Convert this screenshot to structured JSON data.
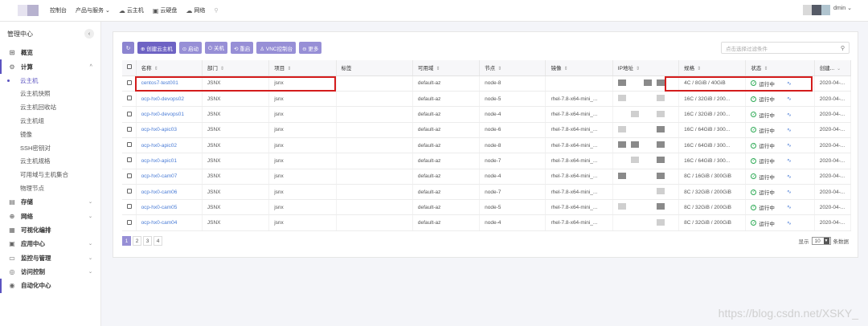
{
  "topbar": {
    "nav": [
      {
        "icon": "",
        "label": "控制台"
      },
      {
        "icon": "",
        "label": "产品与服务 ⌄"
      },
      {
        "icon": "☁",
        "label": "云主机"
      },
      {
        "icon": "▣",
        "label": "云硬盘"
      },
      {
        "icon": "☁",
        "label": "网络"
      }
    ],
    "user": "dmin ⌄"
  },
  "sidebar": {
    "title": "管理中心",
    "items": [
      {
        "icon": "⊞",
        "label": "概览"
      },
      {
        "icon": "⚙",
        "label": "计算",
        "chevron": "^"
      },
      {
        "icon": "▤",
        "label": "存储",
        "chevron": "⌄"
      },
      {
        "icon": "⊕",
        "label": "网络",
        "chevron": "⌄"
      },
      {
        "icon": "▦",
        "label": "可视化编排"
      },
      {
        "icon": "▣",
        "label": "应用中心",
        "chevron": "⌄"
      },
      {
        "icon": "▭",
        "label": "监控与管理",
        "chevron": "⌄"
      },
      {
        "icon": "◎",
        "label": "访问控制",
        "chevron": "⌄"
      },
      {
        "icon": "◉",
        "label": "自动化中心"
      }
    ],
    "compute_subitems": [
      "云主机",
      "云主机快照",
      "云主机回收站",
      "云主机组",
      "镜像",
      "SSH密钥对",
      "云主机规格",
      "可用域与主机集合",
      "物理节点"
    ]
  },
  "toolbar": {
    "refresh": "↻",
    "create": "⊕ 创建云主机",
    "start": "⊙ 启动",
    "stop": "⏻ 关机",
    "restart": "⟲ 重启",
    "vnc": "♙ VNC控制台",
    "more": "⊖ 更多"
  },
  "search": {
    "placeholder": "点击选择过滤条件",
    "icon": "search-icon"
  },
  "table": {
    "headers": [
      "名称",
      "部门",
      "项目",
      "标签",
      "可用域",
      "节点",
      "镜像",
      "IP地址",
      "规格",
      "状态",
      "创建..."
    ],
    "rows": [
      {
        "name": "centos7-test001",
        "dept": "JSNX",
        "project": "jsnx",
        "tag": "",
        "az": "default-az",
        "node": "node-8",
        "image": "",
        "spec": "4C / 8GiB / 40GiB",
        "status": "运行中",
        "created": "2020-04-..."
      },
      {
        "name": "ocp-hx0-devops02",
        "dept": "JSNX",
        "project": "jsnx",
        "tag": "",
        "az": "default-az",
        "node": "node-5",
        "image": "rhel-7.8-x64-mini_...",
        "spec": "16C / 32GiB / 200...",
        "status": "运行中",
        "created": "2020-04-..."
      },
      {
        "name": "ocp-hx0-devops01",
        "dept": "JSNX",
        "project": "jsnx",
        "tag": "",
        "az": "default-az",
        "node": "node-4",
        "image": "rhel-7.8-x64-mini_...",
        "spec": "16C / 32GiB / 200...",
        "status": "运行中",
        "created": "2020-04-..."
      },
      {
        "name": "ocp-hx0-apic03",
        "dept": "JSNX",
        "project": "jsnx",
        "tag": "",
        "az": "default-az",
        "node": "node-6",
        "image": "rhel-7.8-x64-mini_...",
        "spec": "16C / 64GiB / 300...",
        "status": "运行中",
        "created": "2020-04-..."
      },
      {
        "name": "ocp-hx0-apic02",
        "dept": "JSNX",
        "project": "jsnx",
        "tag": "",
        "az": "default-az",
        "node": "node-8",
        "image": "rhel-7.8-x64-mini_...",
        "spec": "16C / 64GiB / 300...",
        "status": "运行中",
        "created": "2020-04-..."
      },
      {
        "name": "ocp-hx0-apic01",
        "dept": "JSNX",
        "project": "jsnx",
        "tag": "",
        "az": "default-az",
        "node": "node-7",
        "image": "rhel-7.8-x64-mini_...",
        "spec": "16C / 64GiB / 300...",
        "status": "运行中",
        "created": "2020-04-..."
      },
      {
        "name": "ocp-hx0-cam07",
        "dept": "JSNX",
        "project": "jsnx",
        "tag": "",
        "az": "default-az",
        "node": "node-4",
        "image": "rhel-7.8-x64-mini_...",
        "spec": "8C / 16GiB / 300GiB",
        "status": "运行中",
        "created": "2020-04-..."
      },
      {
        "name": "ocp-hx0-cam06",
        "dept": "JSNX",
        "project": "jsnx",
        "tag": "",
        "az": "default-az",
        "node": "node-7",
        "image": "rhel-7.8-x64-mini_...",
        "spec": "8C / 32GiB / 200GiB",
        "status": "运行中",
        "created": "2020-04-..."
      },
      {
        "name": "ocp-hx0-cam05",
        "dept": "JSNX",
        "project": "jsnx",
        "tag": "",
        "az": "default-az",
        "node": "node-5",
        "image": "rhel-7.8-x64-mini_...",
        "spec": "8C / 32GiB / 200GiB",
        "status": "运行中",
        "created": "2020-04-..."
      },
      {
        "name": "ocp-hx0-cam04",
        "dept": "JSNX",
        "project": "jsnx",
        "tag": "",
        "az": "default-az",
        "node": "node-4",
        "image": "rhel-7.8-x64-mini_...",
        "spec": "8C / 32GiB / 200GiB",
        "status": "运行中",
        "created": "2020-04-..."
      }
    ]
  },
  "pagination": {
    "pages": [
      "1",
      "2",
      "3",
      "4"
    ],
    "show_label": "显示",
    "page_size": "10",
    "suffix": "条数据"
  },
  "watermark": "https://blog.csdn.net/XSKY_",
  "colors": {
    "accent": "#978fd6",
    "highlight": "#d41c1c",
    "status_ok": "#2eaa55",
    "link": "#4a7cd6"
  }
}
